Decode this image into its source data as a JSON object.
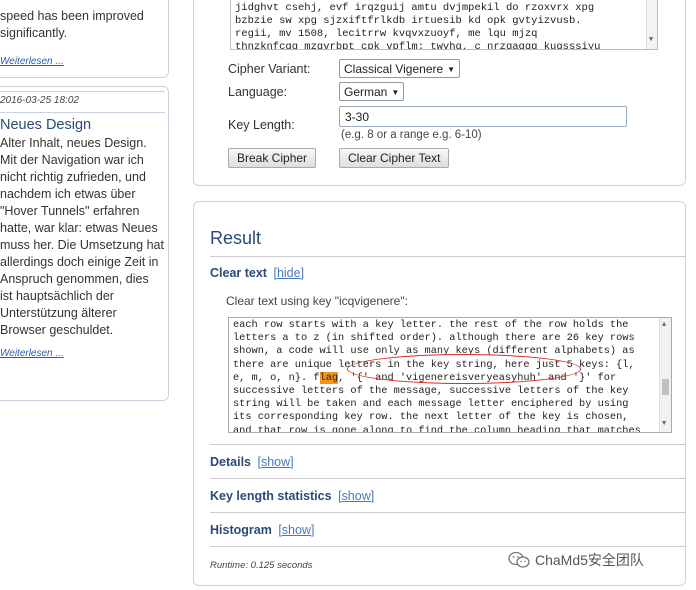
{
  "sidebar": {
    "post1": {
      "snippet_lines": [
        "speed has been improved",
        "significantly."
      ],
      "read_more": "Weiterlesen ..."
    },
    "post2": {
      "date": "2016-03-25 18:02",
      "title": "Neues Design",
      "body_lines": [
        "Alter Inhalt, neues Design.",
        "Mit der Navigation war ich",
        "nicht richtig zufrieden, und",
        "nachdem ich etwas über",
        "\"Hover Tunnels\" erfahren",
        "hatte, war klar: etwas Neues",
        "muss her. Die Umsetzung hat",
        "allerdings doch einige Zeit in",
        "Anspruch genommen, dies",
        "ist hauptsächlich der",
        "Unterstützung älterer",
        "Browser geschuldet."
      ],
      "read_more": "Weiterlesen ..."
    }
  },
  "cipher_form": {
    "input_lines": [
      "jidghvt csehj, evf irqzguij amtu dvjmpekil do rzoxvrx xpg",
      "bzbzie sw xpg sjzxiftfrlkdb irtuesib kd opk gvtyizvusb.",
      "regii, mv 1508, lecitrrw kvqvxzuoyf, me lqu mjzq",
      "thnzknfcgg  mzqvrbpt  cpk  vpflm:  twvhg,  c  nrzgagqg  kugsssiyu"
    ],
    "variant_label": "Cipher Variant:",
    "variant_value": "Classical Vigenere",
    "language_label": "Language:",
    "language_value": "German",
    "key_length_label": "Key Length:",
    "key_length_value": "3-30",
    "key_length_hint": "(e.g. 8 or a range e.g. 6-10)",
    "break_button": "Break Cipher",
    "clear_button": "Clear Cipher Text"
  },
  "result": {
    "title": "Result",
    "clear_text_heading": "Clear text",
    "clear_text_toggle": "hide",
    "clear_text_key_label": "Clear text using key \"icqvigenere\":",
    "text_lines": [
      "each row starts with a key letter. the rest of the row holds the",
      "letters a to z (in shifted order). although there are 26 key rows",
      "shown, a code will use only as many keys (different alphabets) as",
      "there are unique letters in the key string, here just 5 keys: {l,",
      "successive letters of the message, successive letters of the key",
      "string will be taken and each message letter enciphered by using",
      "its corresponding key row. the next letter of the key is chosen,",
      "and that row is gone along to find the column heading that matches"
    ],
    "flag_line": {
      "before": "e, m, o, n}. f",
      "highlight": "lag",
      "after": ", '{' and 'vigenereisveryeasyhuh' and '}' for"
    },
    "details_heading": "Details",
    "details_toggle": "show",
    "keylen_heading": "Key length statistics",
    "keylen_toggle": "show",
    "histogram_heading": "Histogram",
    "histogram_toggle": "show",
    "runtime": "Runtime: 0.125 seconds"
  },
  "watermark": {
    "text": "ChaMd5安全团队"
  }
}
